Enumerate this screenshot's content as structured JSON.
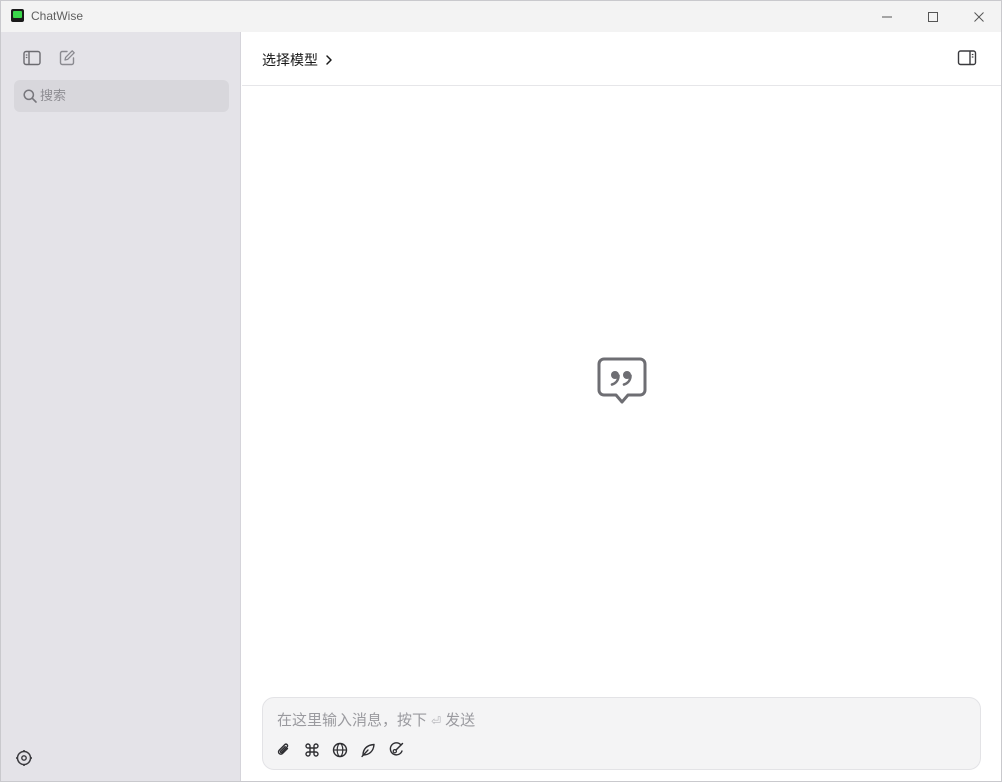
{
  "window": {
    "title": "ChatWise",
    "controls": [
      "minimize-icon",
      "maximize-icon",
      "close-icon"
    ]
  },
  "sidebar": {
    "toggle_icon": "sidebar-toggle-icon",
    "new_chat_icon": "new-chat-icon",
    "search": {
      "placeholder": "搜索",
      "value": "",
      "icon": "search-icon"
    },
    "settings_icon": "settings-icon",
    "background": "#e4e3e8"
  },
  "main": {
    "model_selector": {
      "label": "选择模型",
      "icon": "chevron-right-icon"
    },
    "right_panel_icon": "right-panel-toggle-icon",
    "empty_state_icon": "quote-bubble-icon"
  },
  "composer": {
    "placeholder_before": "在这里输入消息，按下",
    "enter_symbol": "⏎",
    "placeholder_after": "发送",
    "value": "",
    "tools": [
      {
        "name": "attach",
        "icon": "paperclip-icon"
      },
      {
        "name": "command",
        "icon": "command-icon"
      },
      {
        "name": "web",
        "icon": "globe-icon"
      },
      {
        "name": "leaf",
        "icon": "leaf-icon"
      },
      {
        "name": "image-gen",
        "icon": "brush-icon"
      }
    ]
  }
}
